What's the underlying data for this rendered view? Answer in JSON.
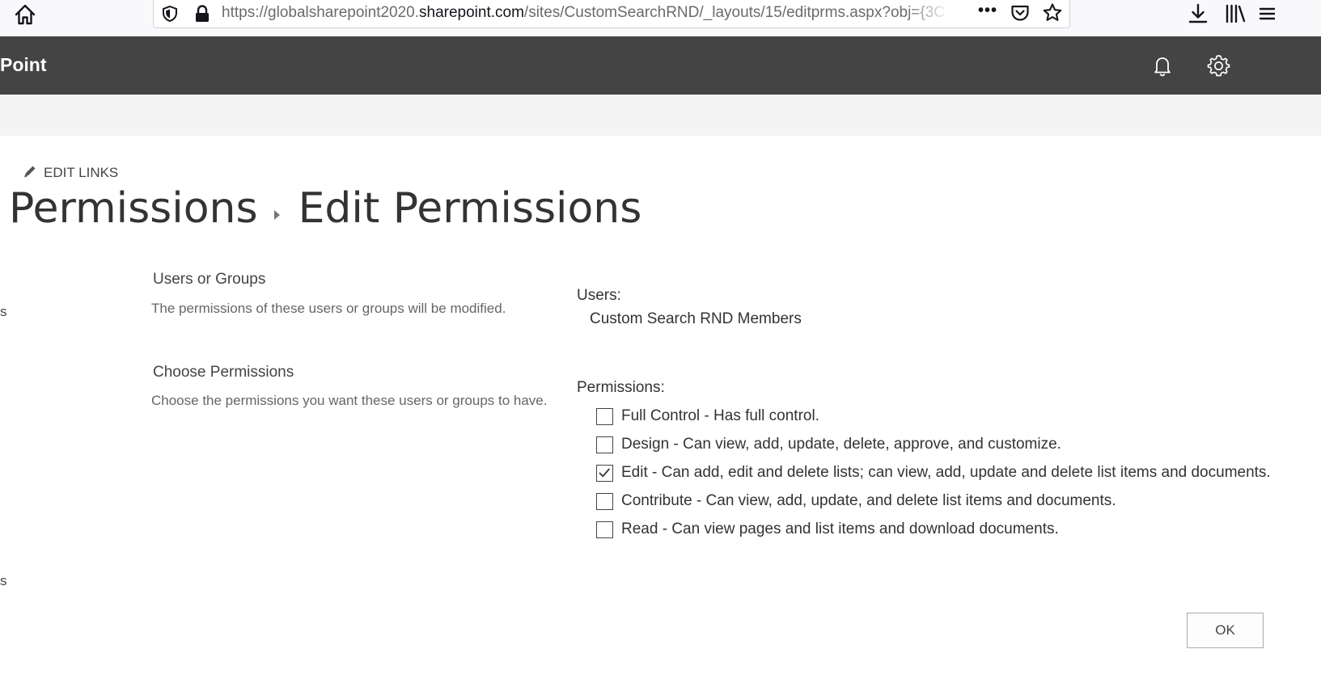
{
  "browser": {
    "url_prefix": "https://globalsharepoint2020.",
    "url_domain": "sharepoint.com",
    "url_path": "/sites/CustomSearchRND/_layouts/15/editprms.aspx?obj={3C",
    "more_label": "•••"
  },
  "suite_bar": {
    "title": "Point"
  },
  "page": {
    "edit_links": "EDIT LINKS",
    "breadcrumb": [
      "Permissions",
      "Edit Permissions"
    ],
    "left_clip_1": "s",
    "left_clip_2": "s"
  },
  "users_section": {
    "title": "Users or Groups",
    "description": "The permissions of these users or groups will be modified.",
    "field_label": "Users:",
    "value": "Custom Search RND Members"
  },
  "permissions_section": {
    "title": "Choose Permissions",
    "description": "Choose the permissions you want these users or groups to have.",
    "field_label": "Permissions:",
    "options": [
      {
        "label": "Full Control - Has full control.",
        "checked": false
      },
      {
        "label": "Design - Can view, add, update, delete, approve, and customize.",
        "checked": false
      },
      {
        "label": "Edit - Can add, edit and delete lists; can view, add, update and delete list items and documents.",
        "checked": true
      },
      {
        "label": "Contribute - Can view, add, update, and delete list items and documents.",
        "checked": false
      },
      {
        "label": "Read - Can view pages and list items and download documents.",
        "checked": false
      }
    ]
  },
  "actions": {
    "ok_label": "OK"
  },
  "colors": {
    "suite_bar": "#444444",
    "sub_band": "#f4f4f4",
    "text": "#333333"
  }
}
